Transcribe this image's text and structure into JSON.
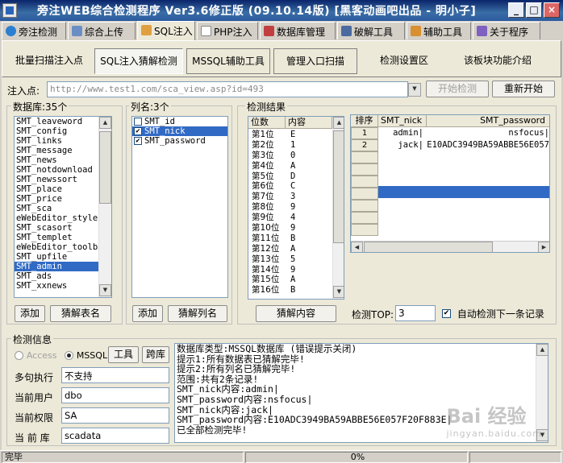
{
  "window": {
    "title": "旁注WEB综合检测程序 Ver3.6修正版 (09.10.14版) [黑客动画吧出品 - 明小子]",
    "minimize": "_",
    "maximize": "□",
    "close": "×"
  },
  "tabs": [
    {
      "label": "旁注检测",
      "color": "#2c7fd0"
    },
    {
      "label": "综合上传",
      "color": "#6b8fc4"
    },
    {
      "label": "SQL注入",
      "color": "#e0a040"
    },
    {
      "label": "PHP注入",
      "color": "#9a9a9a"
    },
    {
      "label": "数据库管理",
      "color": "#c04040"
    },
    {
      "label": "破解工具",
      "color": "#4a6aa0"
    },
    {
      "label": "辅助工具",
      "color": "#d89030"
    },
    {
      "label": "关于程序",
      "color": "#8060c0"
    }
  ],
  "subtabs": [
    {
      "label": "批量扫描注入点"
    },
    {
      "label": "SQL注入猜解检测"
    },
    {
      "label": "MSSQL辅助工具"
    },
    {
      "label": "管理入口扫描"
    },
    {
      "label": "检测设置区"
    },
    {
      "label": "该板块功能介绍"
    }
  ],
  "injection": {
    "label": "注入点:",
    "url": "http://www.test1.com/sca_view.asp?id=493",
    "start_button": "开始检测",
    "restart_button": "重新开始"
  },
  "database": {
    "title": "数据库:35个",
    "items": [
      "SMT_leaveword",
      "SMT_config",
      "SMT_links",
      "SMT_message",
      "SMT_news",
      "SMT_notdownload",
      "SMT_newssort",
      "SMT_place",
      "SMT_price",
      "SMT_sca",
      "eWebEditor_style",
      "SMT_scasort",
      "SMT_templet",
      "eWebEditor_toolbar",
      "SMT_upfile",
      "SMT_admin",
      "SMT_ads",
      "SMT_xxnews"
    ],
    "selected_index": 15,
    "add_button": "添加",
    "guess_button": "猜解表名"
  },
  "columns": {
    "title": "列名:3个",
    "items": [
      {
        "name": "SMT_id",
        "checked": false
      },
      {
        "name": "SMT_nick",
        "checked": true
      },
      {
        "name": "SMT_password",
        "checked": true
      }
    ],
    "selected_index": 1,
    "check_mark": "✔",
    "add_button": "添加",
    "guess_button": "猜解列名"
  },
  "results": {
    "title": "检测结果",
    "digit_header": "位数",
    "content_header": "内容",
    "digits": [
      {
        "pos": "第1位",
        "val": "E"
      },
      {
        "pos": "第2位",
        "val": "1"
      },
      {
        "pos": "第3位",
        "val": "0"
      },
      {
        "pos": "第4位",
        "val": "A"
      },
      {
        "pos": "第5位",
        "val": "D"
      },
      {
        "pos": "第6位",
        "val": "C"
      },
      {
        "pos": "第7位",
        "val": "3"
      },
      {
        "pos": "第8位",
        "val": "9"
      },
      {
        "pos": "第9位",
        "val": "4"
      },
      {
        "pos": "第10位",
        "val": "9"
      },
      {
        "pos": "第11位",
        "val": "B"
      },
      {
        "pos": "第12位",
        "val": "A"
      },
      {
        "pos": "第13位",
        "val": "5"
      },
      {
        "pos": "第14位",
        "val": "9"
      },
      {
        "pos": "第15位",
        "val": "A"
      },
      {
        "pos": "第16位",
        "val": "B"
      }
    ],
    "guess_content_button": "猜解内容",
    "table": {
      "headers": [
        "排序",
        "SMT_nick",
        "SMT_password"
      ],
      "rows": [
        {
          "idx": "1",
          "nick": "admin|",
          "password": "nsfocus|"
        },
        {
          "idx": "2",
          "nick": "jack|",
          "password": "E10ADC3949BA59ABBE56E057"
        }
      ]
    },
    "top_label": "检测TOP:",
    "top_value": "3",
    "auto_next_label": "自动检测下一条记录",
    "auto_next_checked": true
  },
  "info": {
    "title": "检测信息",
    "access_label": "Access",
    "mssql_label": "MSSQL",
    "tools_button": "工具",
    "cross_db_button": "跨库",
    "fields": [
      {
        "label": "多句执行",
        "value": "不支持"
      },
      {
        "label": "当前用户",
        "value": "dbo"
      },
      {
        "label": "当前权限",
        "value": "SA"
      },
      {
        "label": "当 前 库",
        "value": "scadata"
      }
    ],
    "log": [
      "数据库类型:MSSQL数据库 (错误提示关闭)",
      "提示1:所有数据表已猜解完毕!",
      "提示2:所有列名已猜解完毕!",
      "范围:共有2条记录!",
      "SMT_nick内容:admin|",
      "SMT_password内容:nsfocus|",
      "SMT_nick内容:jack|",
      "SMT_password内容:E10ADC3949BA59ABBE56E057F20F883E|",
      "已全部检测完毕!"
    ]
  },
  "status": {
    "left": "完毕",
    "progress": "0%"
  },
  "watermark": {
    "text": "Bai 经验",
    "sub": "jingyan.baidu.com"
  }
}
